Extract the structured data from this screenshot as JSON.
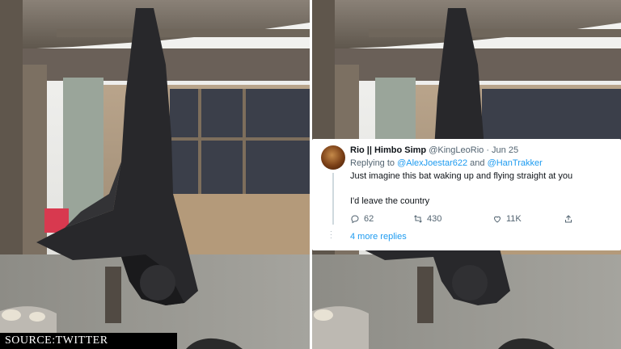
{
  "tweet": {
    "author_name": "Rio || Himbo Simp",
    "handle_meta": "@KingLeoRio · Jun 25",
    "replying_prefix": "Replying to ",
    "reply_user_1": "@AlexJoestar622",
    "reply_joiner": " and ",
    "reply_user_2": "@HanTrakker",
    "text_line_1": "Just imagine this bat waking up and flying straight at you",
    "text_line_2": "I'd leave the country",
    "reply_count": "62",
    "retweet_count": "430",
    "like_count": "11K",
    "more_replies": "4 more replies",
    "accent_color": "#1d9bf0"
  },
  "source_label": "SOURCE:TWITTER",
  "icons": [
    "reply-icon",
    "retweet-icon",
    "like-icon",
    "share-icon",
    "avatar"
  ]
}
